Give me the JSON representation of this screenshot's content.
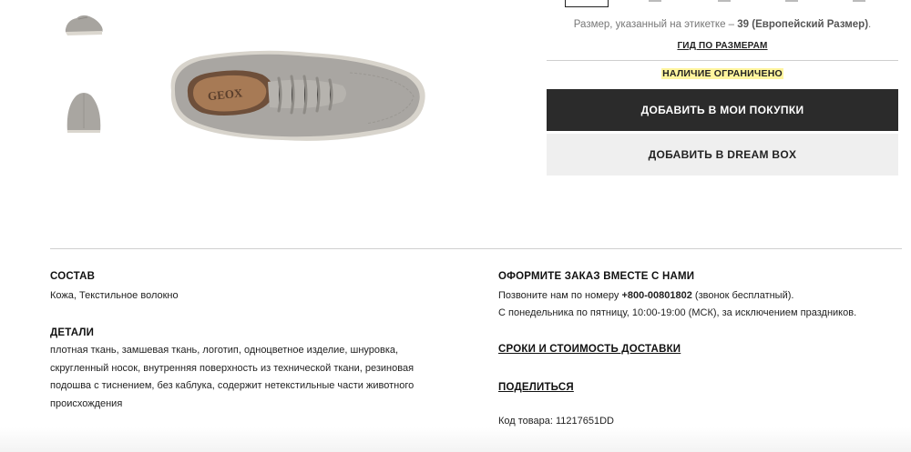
{
  "purchase": {
    "size_note_prefix": "Размер, указанный на этикетке –",
    "size_note_value": "39 (Европейский Размер)",
    "size_note_suffix": ".",
    "size_guide": "ГИД ПО РАЗМЕРАМ",
    "availability": "НАЛИЧИЕ ОГРАНИЧЕНО",
    "add_to_cart": "ДОБАВИТЬ В МОИ ПОКУПКИ",
    "add_to_dreambox": "ДОБАВИТЬ В DREAM BOX"
  },
  "product_image": {
    "brand_insole": "GEOX"
  },
  "details": {
    "composition_title": "СОСТАВ",
    "composition_text": "Кожа, Текстильное волокно",
    "details_title": "ДЕТАЛИ",
    "details_lines": [
      "плотная ткань, замшевая ткань, логотип, одноцветное изделие, шнуровка,",
      "скругленный носок, внутренняя поверхность из технической ткани, резиновая",
      "подошва с тиснением, без каблука, содержит нетекстильные части животного",
      "происхождения"
    ]
  },
  "order": {
    "title": "ОФОРМИТЕ ЗАКАЗ ВМЕСТЕ С НАМИ",
    "phone_prefix": "Позвоните нам по номеру",
    "phone": "+800-00801802",
    "phone_suffix": "(звонок бесплатный).",
    "hours": "С понедельника по пятницу, 10:00-19:00 (МСК), за исключением праздников.",
    "delivery_link": "СРОКИ И СТОИМОСТЬ ДОСТАВКИ",
    "share_link": "ПОДЕЛИТЬСЯ",
    "code_label": "Код товара:",
    "code_value": "11217651DD"
  },
  "colors": {
    "primary_button": "#2b2b2b",
    "secondary_button": "#efefef",
    "highlight": "#fff59e",
    "shoe": "#a9a6a2"
  }
}
